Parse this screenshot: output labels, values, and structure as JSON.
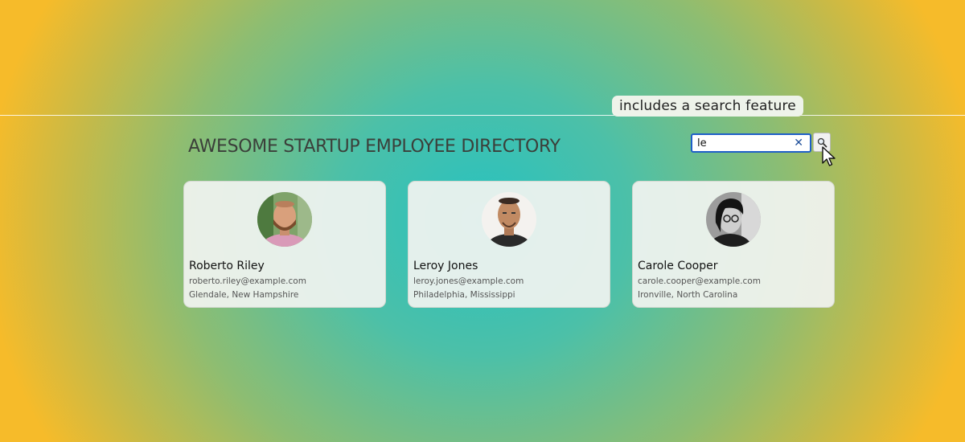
{
  "caption": "includes a search feature",
  "header": {
    "title": "AWESOME STARTUP EMPLOYEE DIRECTORY"
  },
  "search": {
    "value": "le",
    "clear_icon": "✕",
    "button_icon": "magnifier-icon"
  },
  "employees": [
    {
      "name": "Roberto Riley",
      "email": "roberto.riley@example.com",
      "location": "Glendale, New Hampshire"
    },
    {
      "name": "Leroy Jones",
      "email": "leroy.jones@example.com",
      "location": "Philadelphia, Mississippi"
    },
    {
      "name": "Carole Cooper",
      "email": "carole.cooper@example.com",
      "location": "Ironville, North Carolina"
    }
  ],
  "colors": {
    "accent_border": "#1f5fc8",
    "title_text": "#3b3f3a"
  }
}
